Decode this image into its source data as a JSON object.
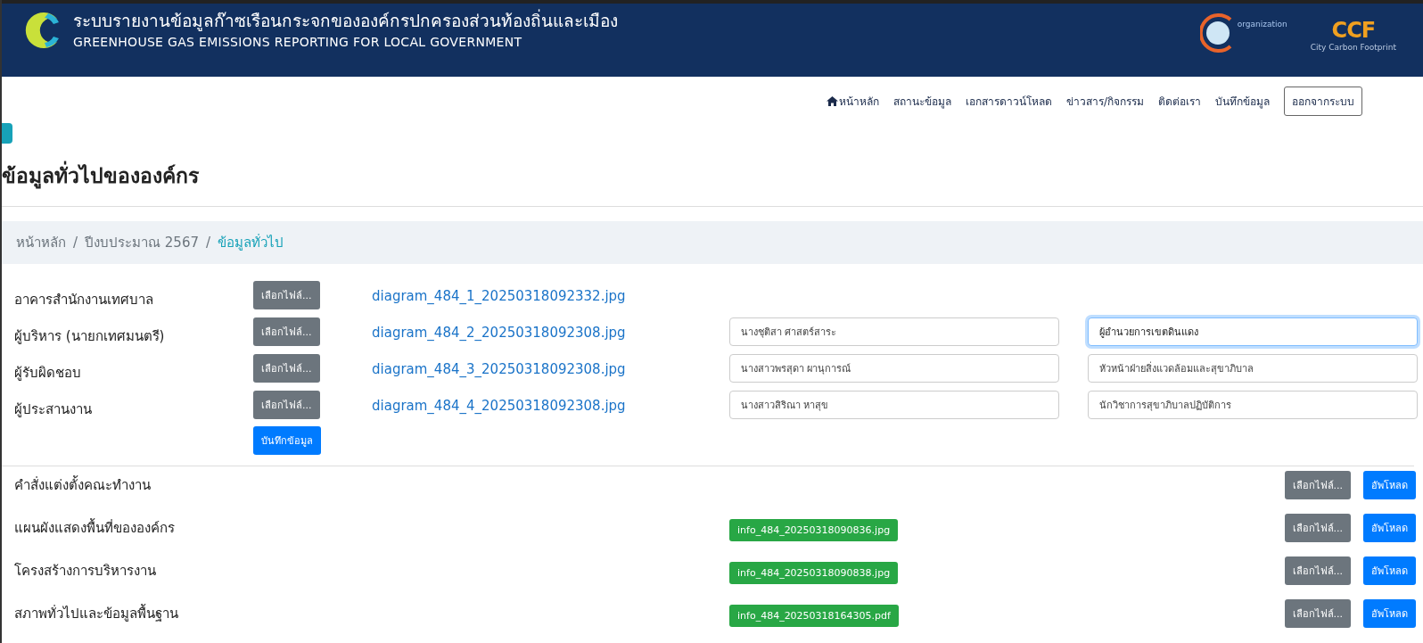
{
  "header": {
    "title": "ระบบรายงานข้อมูลก๊าซเรือนกระจกขององค์กรปกครองส่วนท้องถิ่นและเมือง",
    "subtitle": "GREENHOUSE GAS EMISSIONS REPORTING FOR LOCAL GOVERNMENT",
    "logo_caption": "organization",
    "ccf_logo": "CCF",
    "ccf_caption": "City Carbon Footprint"
  },
  "nav": {
    "items": [
      {
        "label": "หน้าหลัก",
        "kind": "home"
      },
      {
        "label": "สถานะข้อมูล",
        "kind": "link"
      },
      {
        "label": "เอกสารดาวน์โหลด",
        "kind": "link"
      },
      {
        "label": "ข่าวสาร/กิจกรรม",
        "kind": "link"
      },
      {
        "label": "ติดต่อเรา",
        "kind": "link"
      },
      {
        "label": "บันทึกข้อมูล",
        "kind": "link"
      },
      {
        "label": "ออกจากระบบ",
        "kind": "outline"
      }
    ]
  },
  "page_title": "ข้อมูลทั่วไปขององค์กร",
  "breadcrumb_separator": "/",
  "breadcrumb": [
    {
      "label": "หน้าหลัก",
      "selected": false
    },
    {
      "label": "ปีงบประมาณ 2567",
      "selected": false
    },
    {
      "label": "ข้อมูลทั่วไป",
      "selected": true
    }
  ],
  "people": {
    "rows": [
      {
        "label": "อาคารสำนักงานเทศบาล",
        "button": "เลือกไฟล์...",
        "file": "diagram_484_1_20250318092332.jpg"
      },
      {
        "label": "ผู้บริหาร (นายกเทศมนตรี)",
        "button": "เลือกไฟล์...",
        "file": "diagram_484_2_20250318092308.jpg",
        "name": {
          "value": "นางชุติสา ศาสตร์สาระ",
          "focused": false
        },
        "position": {
          "value": "ผู้อำนวยการเขตดินแดง",
          "focused": true
        }
      },
      {
        "label": "ผู้รับผิดชอบ",
        "button": "เลือกไฟล์...",
        "file": "diagram_484_3_20250318092308.jpg",
        "name": {
          "value": "นางสาวพรสุดา ผานุการณ์",
          "focused": false
        },
        "position": {
          "value": "หัวหน้าฝ่ายสิ่งแวดล้อมและสุขาภิบาล",
          "focused": false
        }
      },
      {
        "label": "ผู้ประสานงาน",
        "button": "เลือกไฟล์...",
        "file": "diagram_484_4_20250318092308.jpg",
        "name": {
          "value": "นางสาวสิริณา หาสุข",
          "focused": false
        },
        "position": {
          "value": "นักวิชาการสุขาภิบาลปฏิบัติการ",
          "focused": false
        }
      }
    ],
    "save_button": "บันทึกข้อมูล"
  },
  "documents": [
    {
      "label": "คำสั่งแต่งตั้งคณะทำงาน",
      "choose": "เลือกไฟล์...",
      "upload": "อัพโหลด"
    },
    {
      "label": "แผนผังแสดงพื้นที่ขององค์กร",
      "file": "info_484_20250318090836.jpg",
      "choose": "เลือกไฟล์...",
      "upload": "อัพโหลด"
    },
    {
      "label": "โครงสร้างการบริหารงาน",
      "file": "info_484_20250318090838.jpg",
      "choose": "เลือกไฟล์...",
      "upload": "อัพโหลด"
    },
    {
      "label": "สภาพทั่วไปและข้อมูลพื้นฐาน",
      "file": "info_484_20250318164305.pdf",
      "choose": "เลือกไฟล์...",
      "upload": "อัพโหลด"
    }
  ]
}
